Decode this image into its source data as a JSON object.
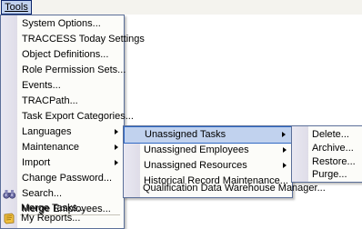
{
  "menubar": {
    "tools": "Tools"
  },
  "main_menu": {
    "items": [
      {
        "label": "System Options..."
      },
      {
        "label": "TRACCESS Today Settings"
      },
      {
        "label": "Object Definitions..."
      },
      {
        "label": "Role Permission Sets..."
      },
      {
        "label": "Events..."
      },
      {
        "label": "TRACPath..."
      },
      {
        "label": "Task Export Categories..."
      },
      {
        "label": "Languages"
      },
      {
        "label": "Maintenance"
      },
      {
        "label": "Import"
      },
      {
        "label": "Change Password..."
      },
      {
        "label": "Search..."
      },
      {
        "label": "Merge Employees..."
      },
      {
        "label": "Merge Tasks..."
      },
      {
        "label": "My Reports..."
      }
    ],
    "icons": {
      "search": "binoculars-icon",
      "reports": "reports-icon"
    }
  },
  "maintenance_menu": {
    "items": [
      {
        "label": "Unassigned Tasks"
      },
      {
        "label": "Unassigned Employees"
      },
      {
        "label": "Unassigned Resources"
      },
      {
        "label": "Historical Record Maintenance..."
      },
      {
        "label": "Qualification Data Warehouse Manager..."
      }
    ]
  },
  "unassigned_tasks_menu": {
    "items": [
      {
        "label": "Delete..."
      },
      {
        "label": "Archive..."
      },
      {
        "label": "Restore..."
      },
      {
        "label": "Purge..."
      }
    ]
  },
  "colors": {
    "highlight": "#c1d2ee",
    "highlight_border": "#316ac5",
    "menu_border": "#5b6f99",
    "menu_bg": "#fcfcf9"
  }
}
